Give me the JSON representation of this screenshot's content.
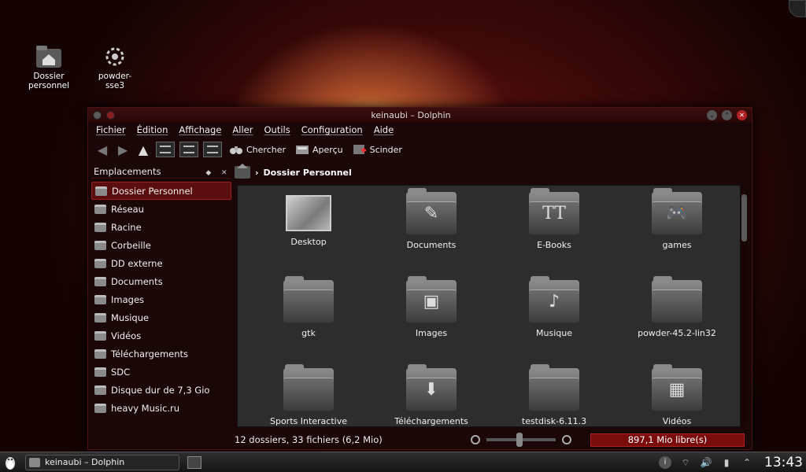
{
  "desktop": {
    "icons": [
      {
        "label": "Dossier personnel"
      },
      {
        "label": "powder-sse3"
      }
    ]
  },
  "window": {
    "title": "keinaubi – Dolphin",
    "menu": [
      "Fichier",
      "Édition",
      "Affichage",
      "Aller",
      "Outils",
      "Configuration",
      "Aide"
    ],
    "toolbar": {
      "search_label": "Chercher",
      "preview_label": "Aperçu",
      "split_label": "Scinder"
    }
  },
  "places_panel": {
    "title": "Emplacements",
    "items": [
      {
        "label": "Dossier Personnel",
        "icon": "home-icon"
      },
      {
        "label": "Réseau",
        "icon": "network-icon"
      },
      {
        "label": "Racine",
        "icon": "root-icon"
      },
      {
        "label": "Corbeille",
        "icon": "trash-icon"
      },
      {
        "label": "DD externe",
        "icon": "drive-icon"
      },
      {
        "label": "Documents",
        "icon": "documents-icon"
      },
      {
        "label": "Images",
        "icon": "images-icon"
      },
      {
        "label": "Musique",
        "icon": "music-icon"
      },
      {
        "label": "Vidéos",
        "icon": "videos-icon"
      },
      {
        "label": "Téléchargements",
        "icon": "downloads-icon"
      },
      {
        "label": "SDC",
        "icon": "sd-card-icon"
      },
      {
        "label": "Disque dur de 7,3 Gio",
        "icon": "hard-disk-icon"
      },
      {
        "label": "heavy Music.ru",
        "icon": "drive-icon"
      }
    ]
  },
  "breadcrumb": {
    "current": "Dossier Personnel"
  },
  "files": [
    {
      "name": "Desktop",
      "emblem": ""
    },
    {
      "name": "Documents",
      "emblem": "✎"
    },
    {
      "name": "E-Books",
      "emblem": "TT"
    },
    {
      "name": "games",
      "emblem": "🎮"
    },
    {
      "name": "gtk",
      "emblem": ""
    },
    {
      "name": "Images",
      "emblem": "▣"
    },
    {
      "name": "Musique",
      "emblem": "♪"
    },
    {
      "name": "powder-45.2-lin32",
      "emblem": ""
    },
    {
      "name": "Sports Interactive",
      "emblem": ""
    },
    {
      "name": "Téléchargements",
      "emblem": "⬇"
    },
    {
      "name": "testdisk-6.11.3",
      "emblem": ""
    },
    {
      "name": "Vidéos",
      "emblem": "▦"
    }
  ],
  "status": {
    "summary": "12 dossiers, 33 fichiers (6,2 Mio)",
    "free_space": "897,1 Mio libre(s)"
  },
  "taskbar": {
    "task_label": "keinaubi – Dolphin",
    "clock": "13:43"
  },
  "colors": {
    "selection": "#5a0e0e",
    "free_bar": "#7a0c0c"
  }
}
